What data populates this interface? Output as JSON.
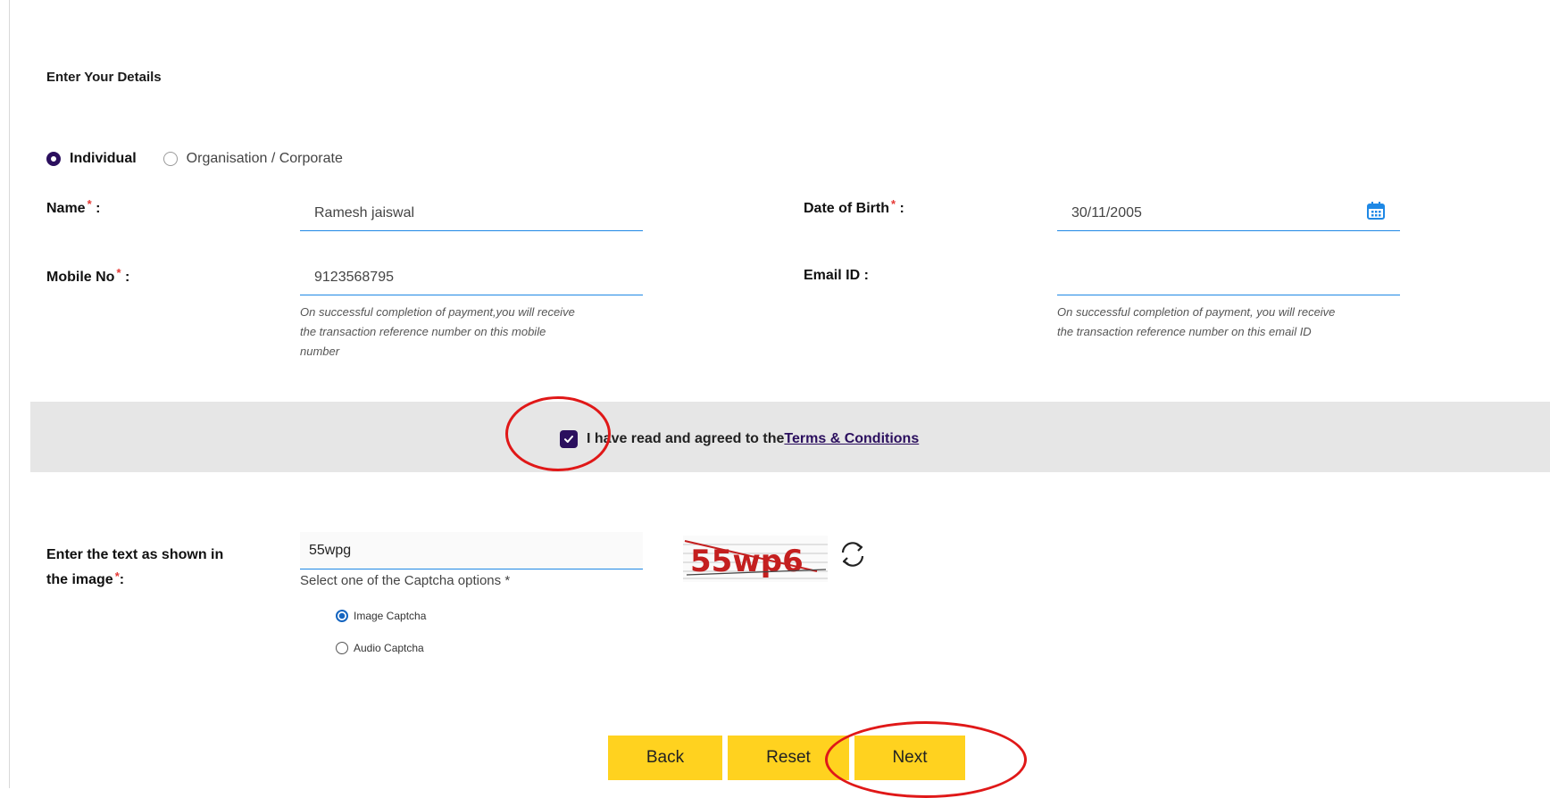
{
  "form": {
    "title": "Enter Your Details",
    "applicant_type": {
      "options": [
        "Individual",
        "Organisation / Corporate"
      ],
      "selected": "Individual"
    },
    "name": {
      "label": "Name",
      "value": "Ramesh jaiswal"
    },
    "dob": {
      "label": "Date of Birth",
      "value": "30/11/2005"
    },
    "mobile": {
      "label": "Mobile No",
      "value": "9123568795",
      "hint_lines": [
        "On successful completion of payment,you will receive",
        "the transaction reference number on this mobile",
        "number"
      ]
    },
    "email": {
      "label": "Email ID :",
      "value": "",
      "hint_lines": [
        "On successful completion of payment, you will receive",
        "the transaction reference number on this email ID"
      ]
    },
    "required_mark": "*",
    "label_colon": ":",
    "terms": {
      "text": "I have read and agreed to the ",
      "link": "Terms & Conditions",
      "checked": true
    },
    "captcha": {
      "label_line1": "Enter the text as shown in",
      "label_line2": "the image",
      "value": "55wpg",
      "image_text": "55wp6",
      "options_prompt": "Select one of the Captcha options *",
      "options": [
        "Image Captcha",
        "Audio Captcha"
      ],
      "selected": "Image Captcha"
    }
  },
  "buttons": {
    "back": "Back",
    "reset": "Reset",
    "next": "Next"
  },
  "colors": {
    "accent": "#2b0f5e",
    "button": "#ffd21f",
    "underline": "#1e88e5",
    "highlight_ring": "#e01818"
  },
  "icons": {
    "calendar": "calendar-icon",
    "refresh": "refresh-icon"
  }
}
